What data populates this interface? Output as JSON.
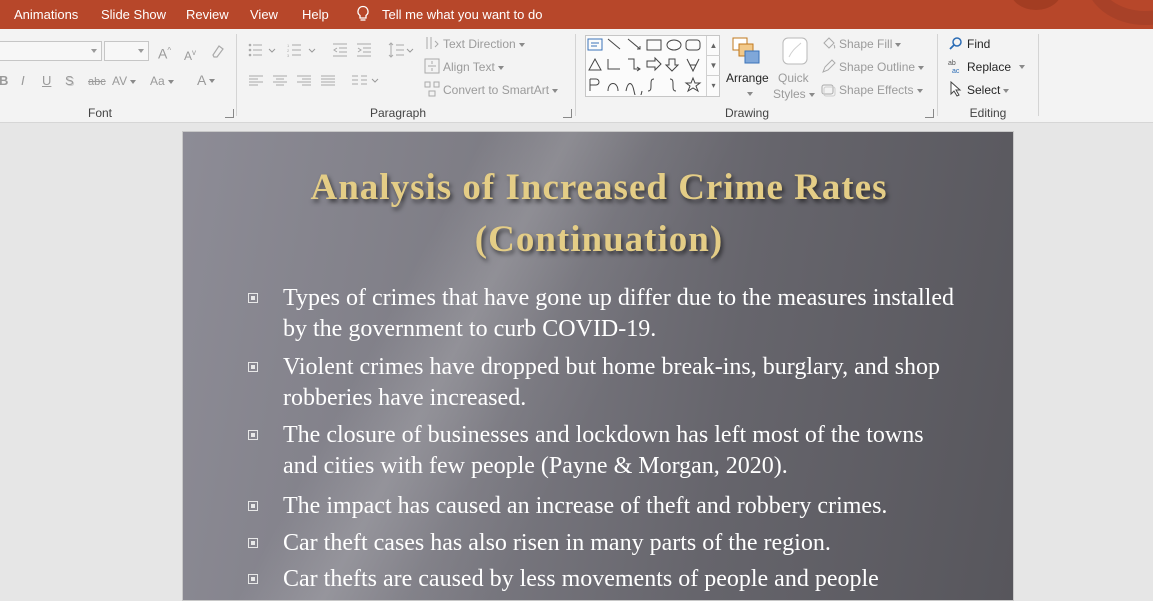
{
  "menubar": {
    "items": [
      "Animations",
      "Slide Show",
      "Review",
      "View",
      "Help"
    ],
    "tell_me": "Tell me what you want to do"
  },
  "ribbon": {
    "groups": {
      "font": "Font",
      "paragraph": "Paragraph",
      "drawing": "Drawing",
      "editing": "Editing"
    },
    "paragraph": {
      "text_direction": "Text Direction",
      "align_text": "Align Text",
      "convert_smartart": "Convert to SmartArt"
    },
    "drawing": {
      "arrange": "Arrange",
      "quick_styles_1": "Quick",
      "quick_styles_2": "Styles",
      "shape_fill": "Shape Fill",
      "shape_outline": "Shape Outline",
      "shape_effects": "Shape Effects"
    },
    "editing": {
      "find": "Find",
      "replace": "Replace",
      "select": "Select"
    },
    "font_glyphs": {
      "grow": "A",
      "shrink": "A",
      "bold": "B",
      "italic": "I",
      "underline": "U",
      "shadow": "S",
      "strike": "abc",
      "spacing": "AV",
      "case": "Aa",
      "color": "A"
    }
  },
  "slide": {
    "title_line1": "Analysis of Increased Crime Rates",
    "title_line2": "(Continuation)",
    "bullets": [
      "Types of crimes that have gone up differ due to the measures installed by the government to curb COVID-19.",
      "Violent crimes have dropped but home break-ins, burglary, and shop robberies have increased.",
      "The closure of businesses and lockdown has left most of the towns and cities with few people (Payne & Morgan, 2020).",
      "The impact has caused an increase of theft and robbery crimes.",
      "Car theft cases has also risen in many parts of the region.",
      "Car thefts are caused by less movements of people and people"
    ]
  },
  "colors": {
    "title_bar": "#b7472a",
    "ribbon": "#f3f3f3",
    "title_text": "#e4cd86",
    "body_text": "#ffffff"
  }
}
